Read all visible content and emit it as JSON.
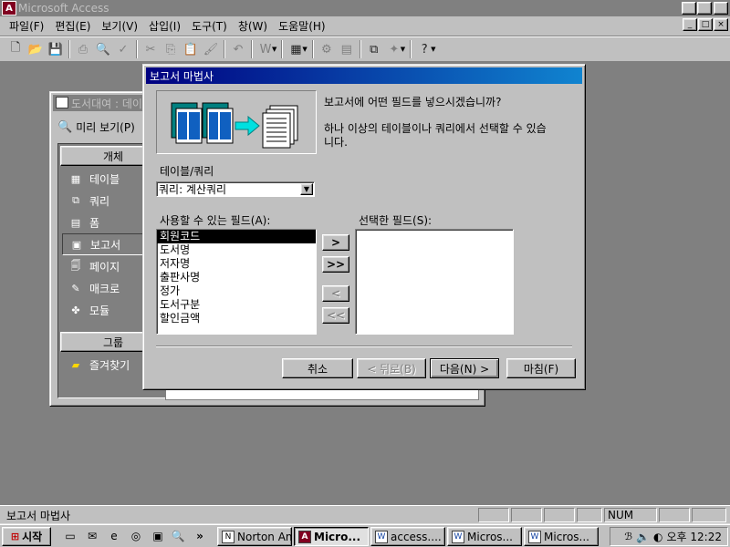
{
  "app": {
    "title": "Microsoft Access",
    "icon": "A",
    "controls": [
      "_",
      "□",
      "×"
    ]
  },
  "menubar": {
    "items": [
      "파일(F)",
      "편집(E)",
      "보기(V)",
      "삽입(I)",
      "도구(T)",
      "창(W)",
      "도움말(H)"
    ],
    "mdi_controls": [
      "_",
      "□",
      "×"
    ]
  },
  "toolbar": {
    "icons": [
      "new-icon",
      "open-icon",
      "save-icon",
      "print-icon",
      "print-preview-icon",
      "spelling-icon",
      "cut-icon",
      "copy-icon",
      "paste-icon",
      "format-painter-icon",
      "undo-icon",
      "office-links-icon",
      "analyze-icon",
      "properties-icon",
      "relationships-icon",
      "new-object-icon",
      "help-icon"
    ]
  },
  "db_window": {
    "title": "도서대여 : 데이",
    "preview_label": "미리 보기(P)",
    "objects_header": "개체",
    "objects": [
      {
        "label": "테이블",
        "icon": "table-icon"
      },
      {
        "label": "쿼리",
        "icon": "query-icon"
      },
      {
        "label": "폼",
        "icon": "form-icon"
      },
      {
        "label": "보고서",
        "icon": "report-icon",
        "active": true
      },
      {
        "label": "페이지",
        "icon": "page-icon"
      },
      {
        "label": "매크로",
        "icon": "macro-icon"
      },
      {
        "label": "모듈",
        "icon": "module-icon"
      }
    ],
    "groups_header": "그룹",
    "favorites_label": "즐겨찾기"
  },
  "dialog": {
    "title": "보고서 마법사",
    "question": "보고서에 어떤 필드를 넣으시겠습니까?",
    "hint_line1": "하나 이상의 테이블이나 쿼리에서 선택할 수 있습",
    "hint_line2": "니다.",
    "table_query_label": "테이블/쿼리",
    "table_query_value": "쿼리: 계산쿼리",
    "available_label": "사용할 수 있는 필드(A):",
    "selected_label": "선택한 필드(S):",
    "available_fields": [
      "회원코드",
      "도서명",
      "저자명",
      "출판사명",
      "정가",
      "도서구분",
      "할인금액"
    ],
    "selected_fields": [],
    "move_buttons": [
      ">",
      ">>",
      "<",
      "<<"
    ],
    "cancel_label": "취소",
    "back_label": "< 뒤로(B)",
    "next_label": "다음(N) >",
    "finish_label": "마침(F)"
  },
  "statusbar": {
    "text": "보고서 마법사",
    "num": "NUM"
  },
  "taskbar": {
    "start_label": "시작",
    "tasks": [
      {
        "label": "Norton Anti...",
        "icon": "norton-icon",
        "active": false
      },
      {
        "label": "Micro...",
        "icon": "access-icon",
        "active": true
      },
      {
        "label": "access....",
        "icon": "word-icon",
        "active": false
      },
      {
        "label": "Micros...",
        "icon": "word-icon",
        "active": false
      },
      {
        "label": "Micros...",
        "icon": "word-icon",
        "active": false
      }
    ],
    "overflow": "»",
    "clock": "오후 12:22"
  }
}
